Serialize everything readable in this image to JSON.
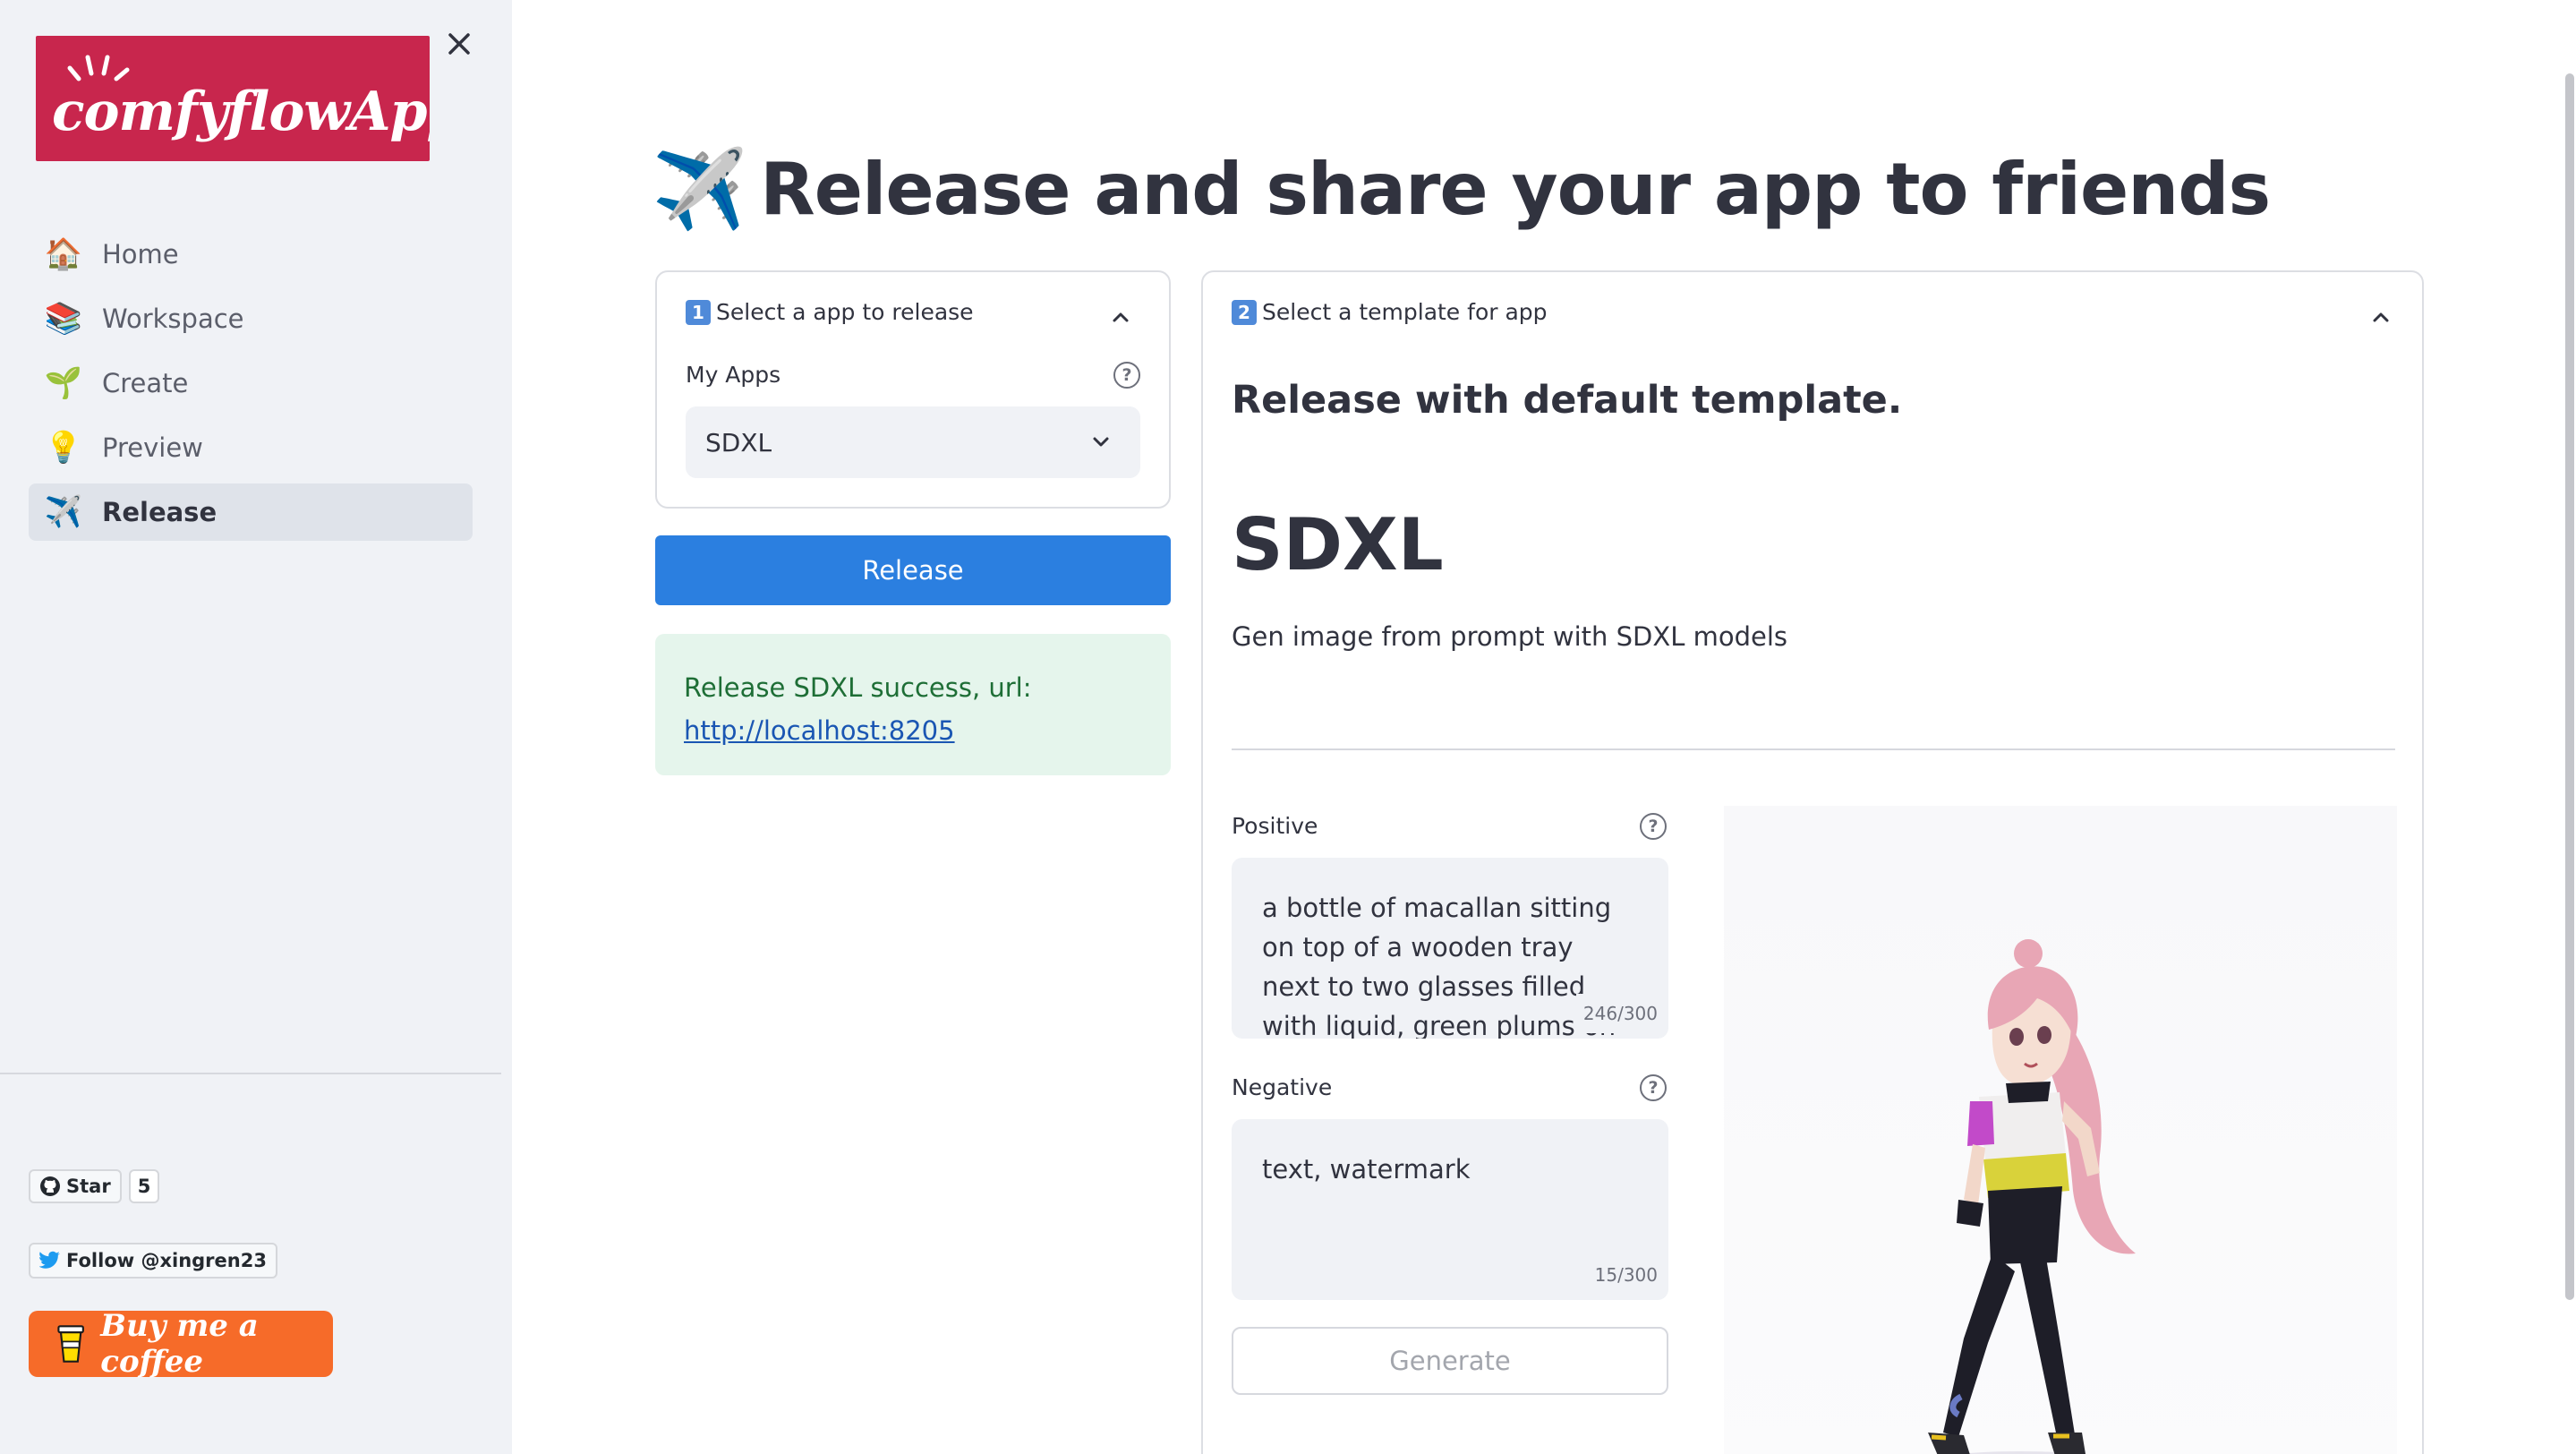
{
  "sidebar": {
    "logo_text": "comfyflowApp",
    "nav": [
      {
        "emoji": "🏠",
        "label": "Home",
        "active": false
      },
      {
        "emoji": "📚",
        "label": "Workspace",
        "active": false
      },
      {
        "emoji": "🌱",
        "label": "Create",
        "active": false
      },
      {
        "emoji": "💡",
        "label": "Preview",
        "active": false
      },
      {
        "emoji": "✈️",
        "label": "Release",
        "active": true
      }
    ],
    "github": {
      "label": "Star",
      "count": "5"
    },
    "twitter": {
      "label": "Follow @xingren23"
    },
    "coffee": {
      "label": "Buy me a coffee"
    }
  },
  "main": {
    "title_emoji": "✈️",
    "title": "Release and share your app to friends",
    "select_card": {
      "step": "1",
      "header": "Select a app to release",
      "field_label": "My Apps",
      "selected_value": "SDXL"
    },
    "release_button": "Release",
    "success": {
      "message": "Release SDXL success, url:",
      "url": "http://localhost:8205"
    },
    "template_card": {
      "step": "2",
      "header": "Select a template for app",
      "heading": "Release with default template.",
      "app_name": "SDXL",
      "app_description": "Gen image from prompt with SDXL models",
      "positive_label": "Positive",
      "positive_value": "a bottle of macallan sitting on top of a wooden tray next to two glasses filled with liquid, green plums on the table,",
      "positive_count": "246/300",
      "negative_label": "Negative",
      "negative_value": "text, watermark",
      "negative_count": "15/300",
      "generate_button": "Generate"
    }
  },
  "colors": {
    "sidebar_bg": "#f0f2f6",
    "primary": "#2b7fe0",
    "success_bg": "#e5f5ec",
    "success_text": "#1e6e36",
    "logo_bg": "#c8264d",
    "coffee_bg": "#f66b29"
  }
}
